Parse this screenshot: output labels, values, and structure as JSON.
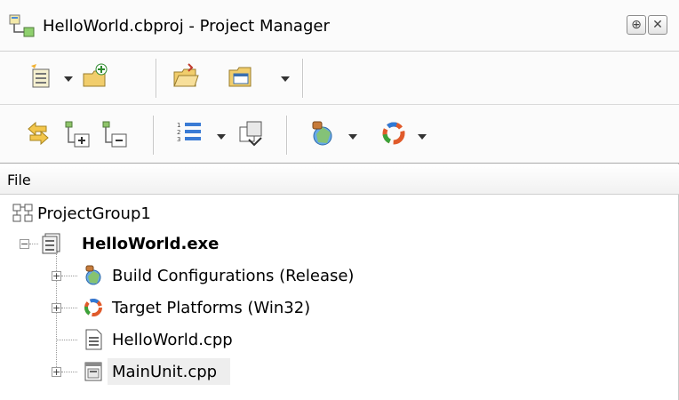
{
  "title": {
    "text": "HelloWorld.cbproj - Project Manager",
    "pin_glyph": "⊕",
    "close_glyph": "✕"
  },
  "toolbar1": {
    "items": [
      "activate-project-icon",
      "add-new-project-icon",
      "open-project-icon",
      "view-icon"
    ]
  },
  "toolbar2": {
    "items": [
      "sync-icon",
      "expand-icon",
      "collapse-icon",
      "build-order-icon",
      "make-icon",
      "build-config-icon",
      "platform-icon"
    ]
  },
  "header": {
    "file_label": "File"
  },
  "tree": {
    "group": "ProjectGroup1",
    "project": "HelloWorld.exe",
    "children": [
      {
        "label": "Build Configurations (Release)",
        "icon": "build-config-icon",
        "expander": "+"
      },
      {
        "label": "Target Platforms (Win32)",
        "icon": "target-platform-icon",
        "expander": "+"
      },
      {
        "label": "HelloWorld.cpp",
        "icon": "cpp-file-icon",
        "expander": ""
      },
      {
        "label": "MainUnit.cpp",
        "icon": "form-unit-icon",
        "expander": "+"
      }
    ]
  },
  "colors": {
    "chrome": "#fbfbfb",
    "border": "#cfcfcf",
    "selection": "#eeeeee"
  }
}
